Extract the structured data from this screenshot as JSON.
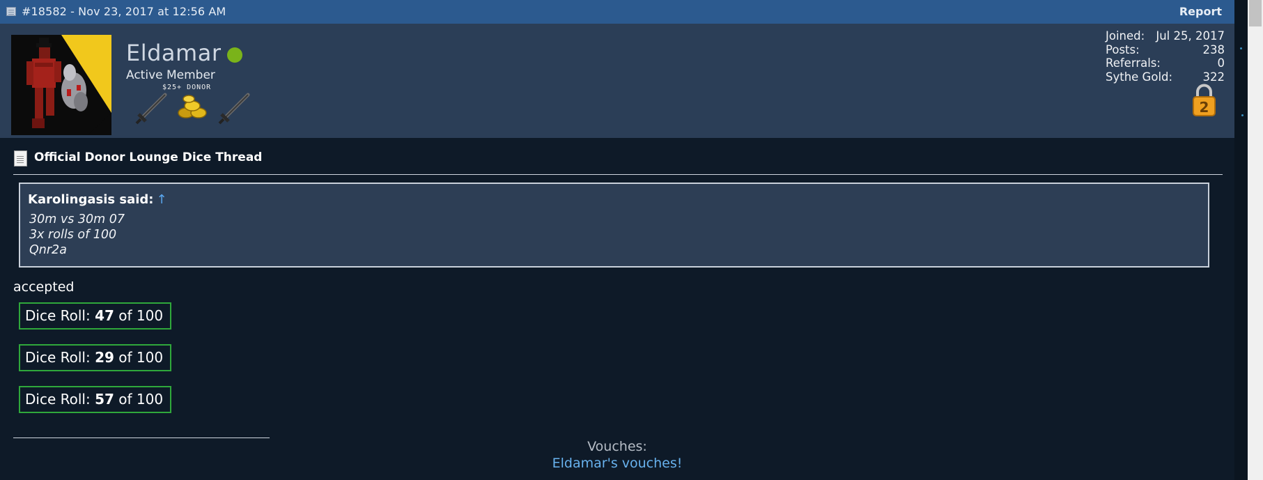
{
  "post": {
    "meta": "#18582 - Nov 23, 2017 at 12:56 AM",
    "report_label": "Report"
  },
  "user": {
    "name": "Eldamar",
    "status": "online",
    "title": "Active Member",
    "donor_tag": "$25+ DONOR",
    "stats": [
      {
        "label": "Joined:",
        "value": "Jul 25, 2017"
      },
      {
        "label": "Posts:",
        "value": "238"
      },
      {
        "label": "Referrals:",
        "value": "0"
      },
      {
        "label": "Sythe Gold:",
        "value": "322"
      }
    ],
    "lock_number": "2"
  },
  "thread": {
    "title": "Official Donor Lounge Dice Thread"
  },
  "quote": {
    "author": "Karolingasis said:",
    "arrow": "↑",
    "lines": [
      "30m vs 30m 07",
      "3x rolls of 100",
      "Qnr2a"
    ]
  },
  "reply": {
    "text": "accepted"
  },
  "dice_rolls": [
    {
      "prefix": "Dice Roll: ",
      "value": "47",
      "suffix": " of 100"
    },
    {
      "prefix": "Dice Roll: ",
      "value": "29",
      "suffix": " of 100"
    },
    {
      "prefix": "Dice Roll: ",
      "value": "57",
      "suffix": " of 100"
    }
  ],
  "vouches": {
    "label": "Vouches:",
    "link": "Eldamar's vouches!"
  },
  "colors": {
    "header_bar": "#2c5a8f",
    "user_panel": "#2b3e57",
    "body": "#0e1a28",
    "online": "#7ab31a",
    "dice_border": "#2fa83b",
    "link": "#68b2ee"
  }
}
